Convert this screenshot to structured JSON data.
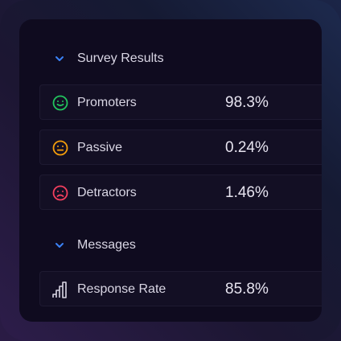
{
  "sections": [
    {
      "title": "Survey Results",
      "items": [
        {
          "label": "Promoters",
          "value": "98.3%",
          "icon": "smile-icon",
          "color": "#22c55e"
        },
        {
          "label": "Passive",
          "value": "0.24%",
          "icon": "neutral-face-icon",
          "color": "#f59e0b"
        },
        {
          "label": "Detractors",
          "value": "1.46%",
          "icon": "frown-icon",
          "color": "#f43f5e"
        }
      ]
    },
    {
      "title": "Messages",
      "items": [
        {
          "label": "Response Rate",
          "value": "85.8%",
          "icon": "bar-chart-icon",
          "color": "#d9d6e4"
        }
      ]
    }
  ],
  "colors": {
    "chevron": "#3b82f6",
    "panel": "#0f0b1f",
    "row": "#130f24"
  }
}
